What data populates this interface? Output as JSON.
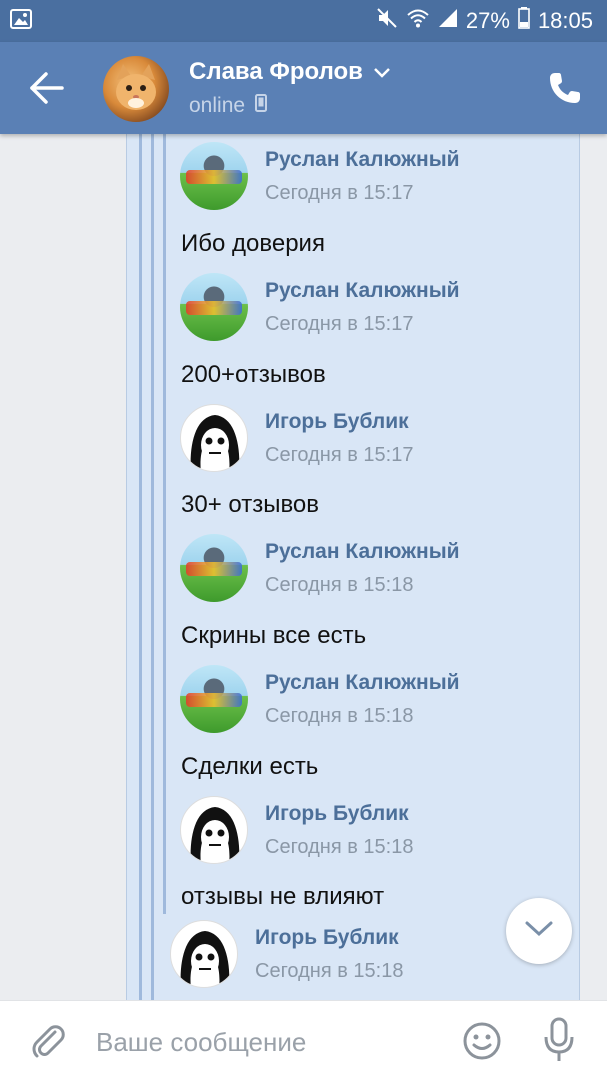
{
  "status_bar": {
    "battery": "27%",
    "time": "18:05"
  },
  "header": {
    "name": "Слава Фролов",
    "status": "online"
  },
  "messages": [
    {
      "sender": "Руслан Калюжный",
      "time": "Сегодня в 15:17",
      "text": "Ибо доверия",
      "avatar": "ruslan"
    },
    {
      "sender": "Руслан Калюжный",
      "time": "Сегодня в 15:17",
      "text": "200+отзывов",
      "avatar": "ruslan"
    },
    {
      "sender": "Игорь Бублик",
      "time": "Сегодня в 15:17",
      "text": "30+ отзывов",
      "avatar": "igor"
    },
    {
      "sender": "Руслан Калюжный",
      "time": "Сегодня в 15:18",
      "text": "Скрины все есть",
      "avatar": "ruslan"
    },
    {
      "sender": "Руслан Калюжный",
      "time": "Сегодня в 15:18",
      "text": "Сделки есть",
      "avatar": "ruslan"
    },
    {
      "sender": "Игорь Бублик",
      "time": "Сегодня в 15:18",
      "text": "отзывы не влияют",
      "avatar": "igor"
    },
    {
      "sender": "Игорь Бублик",
      "time": "Сегодня в 15:18",
      "text": "",
      "avatar": "igor"
    }
  ],
  "input": {
    "placeholder": "Ваше сообщение",
    "value": ""
  },
  "colors": {
    "header": "#5a80b5",
    "status_bar": "#4a6fa0",
    "bubble": "#d9e6f6",
    "sender": "#4c6f99",
    "time": "#8a97a6"
  }
}
